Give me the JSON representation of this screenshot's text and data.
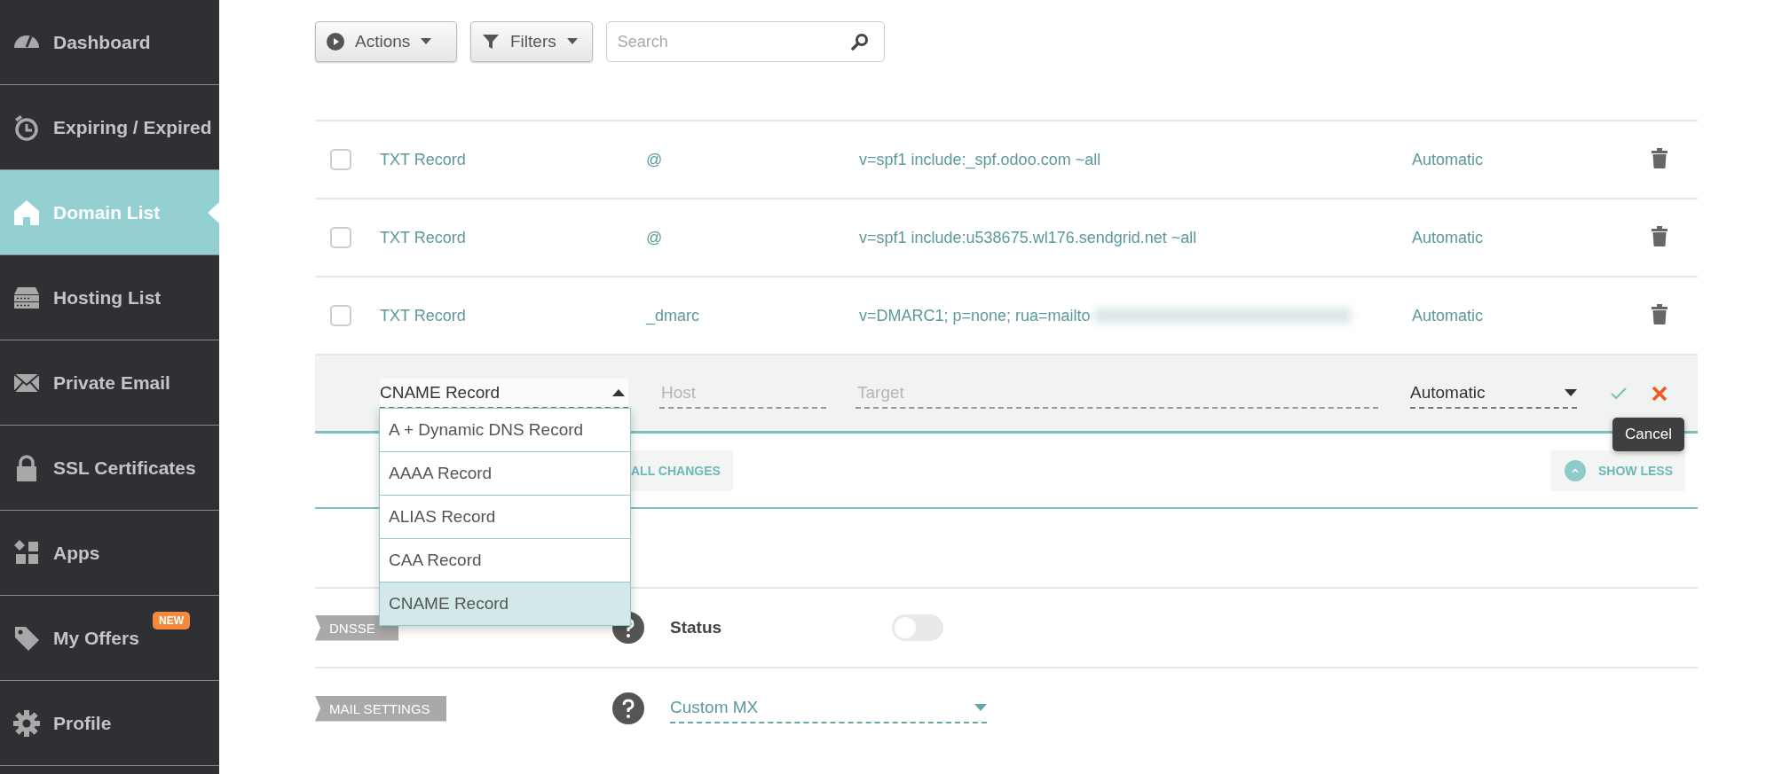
{
  "sidebar": {
    "items": [
      {
        "label": "Dashboard",
        "selected": false
      },
      {
        "label": "Expiring / Expired",
        "selected": false
      },
      {
        "label": "Domain List",
        "selected": true
      },
      {
        "label": "Hosting List",
        "selected": false
      },
      {
        "label": "Private Email",
        "selected": false
      },
      {
        "label": "SSL Certificates",
        "selected": false
      },
      {
        "label": "Apps",
        "selected": false
      },
      {
        "label": "My Offers",
        "selected": false,
        "badge": "NEW"
      },
      {
        "label": "Profile",
        "selected": false
      }
    ]
  },
  "toolbar": {
    "actions_button": "Actions",
    "filters_button": "Filters",
    "search": {
      "placeholder": "Search"
    }
  },
  "records": [
    {
      "type": "TXT Record",
      "host": "@",
      "value": "v=spf1 include:_spf.odoo.com ~all",
      "redacted": false,
      "ttl": "Automatic",
      "checked": false
    },
    {
      "type": "TXT Record",
      "host": "@",
      "value": "v=spf1 include:u538675.wl176.sendgrid.net ~all",
      "redacted": false,
      "ttl": "Automatic",
      "checked": false
    },
    {
      "type": "TXT Record",
      "host": "_dmarc",
      "value": "v=DMARC1; p=none; rua=mailto",
      "redacted": true,
      "ttl": "Automatic",
      "checked": false
    }
  ],
  "edit_row": {
    "type": "CNAME Record",
    "expanded": true,
    "host_placeholder": "Host",
    "target_placeholder": "Target",
    "ttl": "Automatic",
    "tooltip": "Cancel"
  },
  "type_menu": [
    {
      "label": "A + Dynamic DNS Record",
      "selected": false
    },
    {
      "label": "AAAA Record",
      "selected": false
    },
    {
      "label": "ALIAS Record",
      "selected": false
    },
    {
      "label": "CAA Record",
      "selected": false
    },
    {
      "label": "CNAME Record",
      "selected": true
    }
  ],
  "save_button": "ALL CHANGES",
  "show_less_button": "SHOW LESS",
  "dnssec": {
    "tag": "DNSSE",
    "status_label": "Status",
    "on": false
  },
  "mail_settings": {
    "tag": "MAIL SETTINGS",
    "value": "Custom MX"
  }
}
